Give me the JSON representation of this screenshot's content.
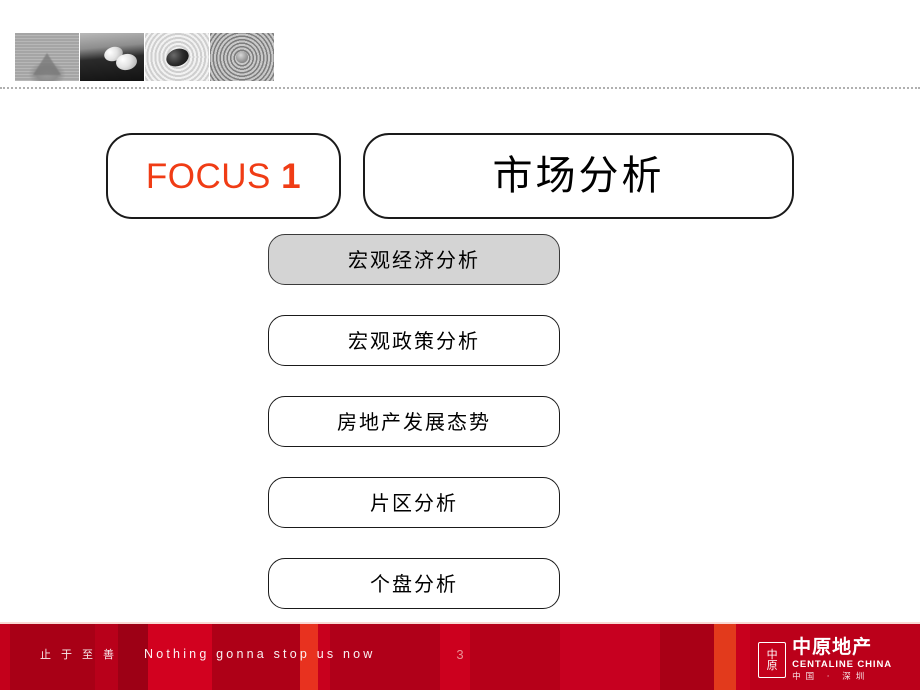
{
  "slide": {
    "page_number": "3"
  },
  "header": {
    "thumbnails": [
      {
        "name": "sand-cone-photo"
      },
      {
        "name": "white-pebbles-photo"
      },
      {
        "name": "dark-stone-ripple-photo"
      },
      {
        "name": "water-rings-photo"
      }
    ]
  },
  "focus": {
    "prefix": "FOCUS ",
    "number": "1"
  },
  "title": {
    "text": "市场分析"
  },
  "sections": [
    {
      "label": "宏观经济分析",
      "active": true
    },
    {
      "label": "宏观政策分析",
      "active": false
    },
    {
      "label": "房地产发展态势",
      "active": false
    },
    {
      "label": "片区分析",
      "active": false
    },
    {
      "label": "个盘分析",
      "active": false
    }
  ],
  "footer": {
    "slogan_cn": "止于至善",
    "slogan_en": "Nothing gonna stop us now",
    "logo": {
      "mark_top": "中",
      "mark_bottom": "原",
      "name_cn": "中原地产",
      "name_en": "CENTALINE CHINA",
      "region": "中国 · 深圳"
    }
  },
  "colors": {
    "brand_red": "#c3001b",
    "focus_orange": "#f03c15",
    "active_gray": "#d4d4d4"
  }
}
